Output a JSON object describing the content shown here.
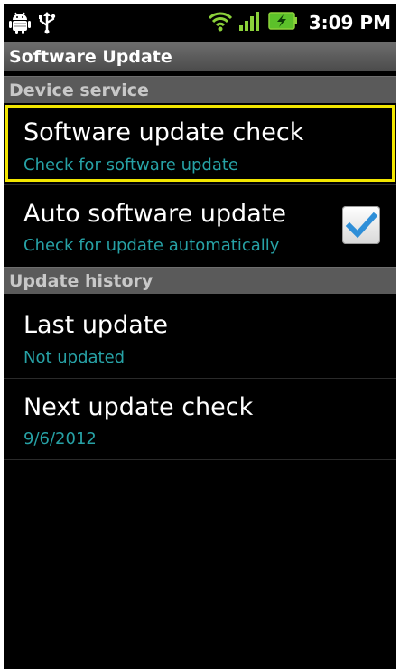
{
  "status_bar": {
    "time": "3:09 PM",
    "icons": [
      "android-debug-icon",
      "usb-icon",
      "wifi-icon",
      "signal-icon",
      "battery-charging-icon"
    ]
  },
  "title_bar": {
    "title": "Software Update"
  },
  "sections": [
    {
      "header": "Device service",
      "items": [
        {
          "title": "Software update check",
          "subtitle": "Check for software update",
          "selected": true
        },
        {
          "title": "Auto software update",
          "subtitle": "Check for update automatically",
          "checked": true
        }
      ]
    },
    {
      "header": "Update history",
      "items": [
        {
          "title": "Last update",
          "subtitle": "Not updated"
        },
        {
          "title": "Next update check",
          "subtitle": "9/6/2012"
        }
      ]
    }
  ],
  "colors": {
    "background": "#000000",
    "subtitle_text": "#27a2a6",
    "highlight_border": "#f2e600",
    "checkbox_check": "#2f8fd8"
  }
}
